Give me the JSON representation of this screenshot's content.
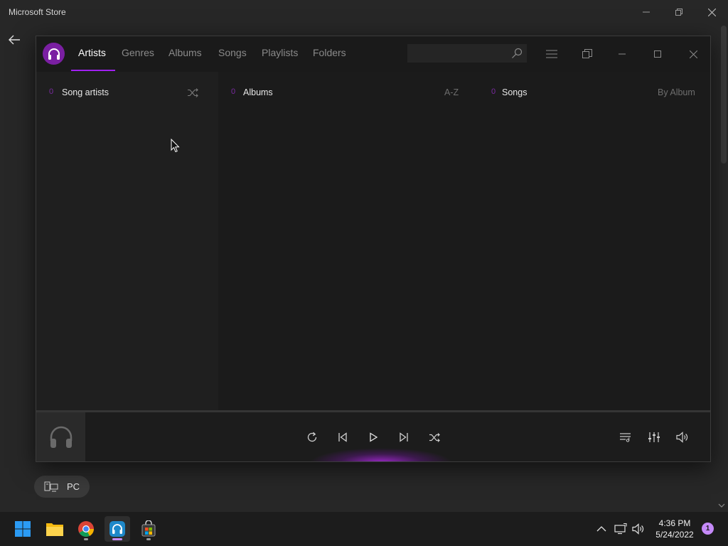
{
  "store": {
    "title": "Microsoft Store",
    "chip_label": "PC"
  },
  "player": {
    "tabs": [
      {
        "label": "Artists",
        "active": true
      },
      {
        "label": "Genres",
        "active": false
      },
      {
        "label": "Albums",
        "active": false
      },
      {
        "label": "Songs",
        "active": false
      },
      {
        "label": "Playlists",
        "active": false
      },
      {
        "label": "Folders",
        "active": false
      }
    ],
    "search": {
      "placeholder": "",
      "value": ""
    },
    "columns": {
      "artists": {
        "count": "0",
        "title": "Song artists",
        "sort_icon": "shuffle-icon"
      },
      "albums": {
        "count": "0",
        "title": "Albums",
        "sort": "A-Z"
      },
      "songs": {
        "count": "0",
        "title": "Songs",
        "sort": "By Album"
      }
    }
  },
  "taskbar": {
    "apps": [
      "start-icon",
      "file-explorer-icon",
      "chrome-icon",
      "music-player-icon",
      "store-icon"
    ],
    "time": "4:36 PM",
    "date": "5/24/2022",
    "notifications": "1"
  },
  "colors": {
    "accent": "#a020f0",
    "logo": "#7a1fa2",
    "taskbar_accent": "#c58af9"
  }
}
